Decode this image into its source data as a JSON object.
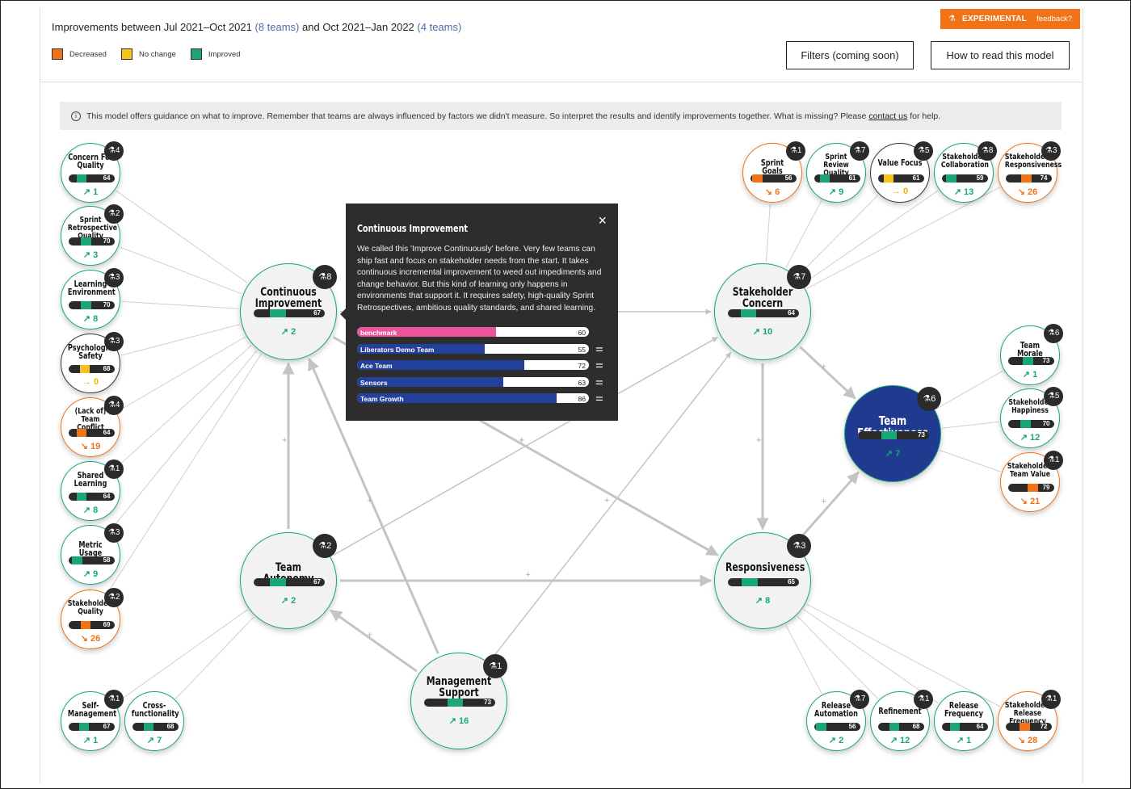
{
  "header": {
    "title_prefix": "Improvements between ",
    "period_a": "Jul 2021–Oct 2021",
    "period_a_teams": " (8 teams)",
    "title_mid": " and ",
    "period_b": "Oct 2021–Jan 2022",
    "period_b_teams": " (4 teams)",
    "legend": [
      {
        "label": "Decreased",
        "color": "#f07318"
      },
      {
        "label": "No change",
        "color": "#f8c21d"
      },
      {
        "label": "Improved",
        "color": "#1aa57a"
      }
    ],
    "experimental_label": "EXPERIMENTAL",
    "feedback_label": "feedback?",
    "filters_button": "Filters (coming soon)",
    "howto_button": "How to read this model"
  },
  "info": {
    "text_before": "This model offers guidance on what to improve. Remember that teams are always influenced by factors we didn't measure. So interpret the results and identify improvements together. What is missing? Please ",
    "link": "contact us",
    "text_after": " for help."
  },
  "colors": {
    "improved": "#1aa57a",
    "decreased": "#f07318",
    "no_change": "#f8c21d",
    "target": "#1f3a8f",
    "benchmark": "#e8559b",
    "team": "#23409a"
  },
  "nodes": [
    {
      "id": "concern-for-quality",
      "label": "Concern For Quality",
      "value": 64,
      "delta": "1",
      "trend": "up",
      "status": "improved",
      "badge": "4"
    },
    {
      "id": "sprint-retrospective-quality",
      "label": "Sprint Retrospective Quality",
      "value": 70,
      "delta": "3",
      "trend": "up",
      "status": "improved",
      "badge": "2"
    },
    {
      "id": "learning-environment",
      "label": "Learning Environment",
      "value": 70,
      "delta": "8",
      "trend": "up",
      "status": "improved",
      "badge": "3"
    },
    {
      "id": "psychological-safety",
      "label": "Psychological Safety",
      "value": 68,
      "delta": "0",
      "trend": "flat",
      "status": "no_change",
      "badge": "3"
    },
    {
      "id": "team-conflict",
      "label": "(Lack of) Team Conflict",
      "value": 64,
      "delta": "19",
      "trend": "down",
      "status": "decreased",
      "badge": "4"
    },
    {
      "id": "shared-learning",
      "label": "Shared Learning",
      "value": 64,
      "delta": "8",
      "trend": "up",
      "status": "improved",
      "badge": "1"
    },
    {
      "id": "metric-usage",
      "label": "Metric Usage",
      "value": 58,
      "delta": "9",
      "trend": "up",
      "status": "improved",
      "badge": "3"
    },
    {
      "id": "stakeholders-quality",
      "label": "Stakeholders: Quality",
      "value": 69,
      "delta": "26",
      "trend": "down",
      "status": "decreased",
      "badge": "2"
    },
    {
      "id": "self-management",
      "label": "Self-Management",
      "value": 67,
      "delta": "1",
      "trend": "up",
      "status": "improved",
      "badge": "1"
    },
    {
      "id": "cross-functionality",
      "label": "Cross-functionality",
      "value": 68,
      "delta": "7",
      "trend": "up",
      "status": "improved",
      "badge": ""
    },
    {
      "id": "continuous-improvement",
      "label": "Continuous Improvement",
      "value": 67,
      "delta": "2",
      "trend": "up",
      "status": "improved",
      "badge": "8"
    },
    {
      "id": "team-autonomy",
      "label": "Team Autonomy",
      "value": 67,
      "delta": "2",
      "trend": "up",
      "status": "improved",
      "badge": "2"
    },
    {
      "id": "management-support",
      "label": "Management Support",
      "value": 73,
      "delta": "16",
      "trend": "up",
      "status": "improved",
      "badge": "1"
    },
    {
      "id": "stakeholder-concern",
      "label": "Stakeholder Concern",
      "value": 64,
      "delta": "10",
      "trend": "up",
      "status": "improved",
      "badge": "7"
    },
    {
      "id": "responsiveness",
      "label": "Responsiveness",
      "value": 65,
      "delta": "8",
      "trend": "up",
      "status": "improved",
      "badge": "3"
    },
    {
      "id": "team-effectiveness",
      "label": "Team Effectiveness",
      "value": 73,
      "delta": "7",
      "trend": "up",
      "status": "target",
      "badge": "6"
    },
    {
      "id": "sprint-goals",
      "label": "Sprint Goals",
      "value": 56,
      "delta": "6",
      "trend": "down",
      "status": "decreased",
      "badge": "1"
    },
    {
      "id": "sprint-review-quality",
      "label": "Sprint Review Quality",
      "value": 61,
      "delta": "9",
      "trend": "up",
      "status": "improved",
      "badge": "7"
    },
    {
      "id": "value-focus",
      "label": "Value Focus",
      "value": 61,
      "delta": "0",
      "trend": "flat",
      "status": "no_change",
      "badge": "5"
    },
    {
      "id": "stakeholder-collaboration",
      "label": "Stakeholder Collaboration",
      "value": 59,
      "delta": "13",
      "trend": "up",
      "status": "improved",
      "badge": "8"
    },
    {
      "id": "stakeholders-responsiveness",
      "label": "Stakeholders: Responsiveness",
      "value": 74,
      "delta": "26",
      "trend": "down",
      "status": "decreased",
      "badge": "3"
    },
    {
      "id": "team-morale",
      "label": "Team Morale",
      "value": 73,
      "delta": "1",
      "trend": "up",
      "status": "improved",
      "badge": "6"
    },
    {
      "id": "stakeholder-happiness",
      "label": "Stakeholder Happiness",
      "value": 70,
      "delta": "12",
      "trend": "up",
      "status": "improved",
      "badge": "5"
    },
    {
      "id": "stakeholders-team-value",
      "label": "Stakeholders: Team Value",
      "value": 79,
      "delta": "21",
      "trend": "down",
      "status": "decreased",
      "badge": "1"
    },
    {
      "id": "release-automation",
      "label": "Release Automation",
      "value": 56,
      "delta": "2",
      "trend": "up",
      "status": "improved",
      "badge": "7"
    },
    {
      "id": "refinement",
      "label": "Refinement",
      "value": 68,
      "delta": "12",
      "trend": "up",
      "status": "improved",
      "badge": "1"
    },
    {
      "id": "release-frequency",
      "label": "Release Frequency",
      "value": 64,
      "delta": "1",
      "trend": "up",
      "status": "improved",
      "badge": ""
    },
    {
      "id": "stakeholders-release-frequency",
      "label": "Stakeholders: Release Frequency",
      "value": 72,
      "delta": "28",
      "trend": "down",
      "status": "decreased",
      "badge": "1"
    }
  ],
  "edge_sign": "+",
  "popover": {
    "title": "Continuous Improvement",
    "text": "We called this 'Improve Continuously' before. Very few teams can ship fast and focus on stakeholder needs from the start. It takes continuous incremental improvement to weed out impediments and change behavior. But this kind of learning only happens in environments that support it. It requires safety, high-quality Sprint Retrospectives, ambitious quality standards, and shared learning.",
    "close_icon": "×",
    "adjust_icon": "⚌",
    "rows": [
      {
        "label": "benchmark",
        "value": 60,
        "kind": "benchmark"
      },
      {
        "label": "Liberators Demo Team",
        "value": 55,
        "kind": "team"
      },
      {
        "label": "Ace Team",
        "value": 72,
        "kind": "team"
      },
      {
        "label": "Sensors",
        "value": 63,
        "kind": "team"
      },
      {
        "label": "Team Growth",
        "value": 86,
        "kind": "team"
      }
    ]
  },
  "icons": {
    "flask": "flask-icon",
    "trend_up": "↗",
    "trend_down": "↘",
    "flat": "→",
    "info": "i"
  }
}
